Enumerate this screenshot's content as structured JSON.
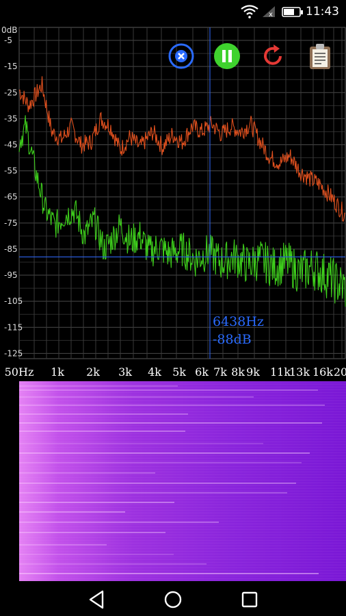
{
  "status_bar": {
    "time": "11:43"
  },
  "toolbar": {
    "buttons": [
      {
        "name": "clear-button",
        "icon": "close-circle-icon",
        "color": "#2a6bff"
      },
      {
        "name": "pause-button",
        "icon": "pause-circle-icon",
        "color": "#3fd22e"
      },
      {
        "name": "refresh-button",
        "icon": "refresh-icon",
        "color": "#e53935"
      },
      {
        "name": "clipboard-button",
        "icon": "clipboard-icon",
        "color": "#8d6e53"
      }
    ]
  },
  "readout": {
    "frequency": "6438Hz",
    "level": "-88dB"
  },
  "chart_data": {
    "type": "line",
    "y_axis": {
      "unit": "0dB",
      "ticks": [
        "-5",
        "-15",
        "-25",
        "-35",
        "-45",
        "-55",
        "-65",
        "-75",
        "-85",
        "-95",
        "-105",
        "-115",
        "-125"
      ]
    },
    "x_axis": {
      "ticks": [
        "50Hz",
        "1k",
        "2k",
        "3k",
        "4k",
        "5k",
        "6k",
        "7k",
        "8k",
        "9k",
        "11k",
        "13k",
        "16k",
        "20"
      ]
    },
    "cursor": {
      "frequency_hz": 6438,
      "level_db": -88
    },
    "series": [
      {
        "color": "#e0501e",
        "points": [
          [
            0,
            -24
          ],
          [
            0.03,
            -30
          ],
          [
            0.07,
            -22
          ],
          [
            0.1,
            -40
          ],
          [
            0.13,
            -43
          ],
          [
            0.16,
            -38
          ],
          [
            0.19,
            -45
          ],
          [
            0.22,
            -44
          ],
          [
            0.25,
            -35
          ],
          [
            0.28,
            -38
          ],
          [
            0.31,
            -47
          ],
          [
            0.34,
            -42
          ],
          [
            0.37,
            -46
          ],
          [
            0.41,
            -40
          ],
          [
            0.44,
            -46
          ],
          [
            0.47,
            -41
          ],
          [
            0.5,
            -44
          ],
          [
            0.53,
            -38
          ],
          [
            0.56,
            -40
          ],
          [
            0.59,
            -37
          ],
          [
            0.62,
            -41
          ],
          [
            0.65,
            -38
          ],
          [
            0.68,
            -40
          ],
          [
            0.71,
            -37
          ],
          [
            0.74,
            -44
          ],
          [
            0.77,
            -50
          ],
          [
            0.8,
            -52
          ],
          [
            0.83,
            -49
          ],
          [
            0.86,
            -55
          ],
          [
            0.89,
            -58
          ],
          [
            0.92,
            -60
          ],
          [
            0.95,
            -64
          ],
          [
            1.0,
            -72
          ]
        ]
      },
      {
        "color": "#3ecf1c",
        "points": [
          [
            0,
            -44
          ],
          [
            0.02,
            -38
          ],
          [
            0.05,
            -55
          ],
          [
            0.08,
            -70
          ],
          [
            0.11,
            -76
          ],
          [
            0.14,
            -72
          ],
          [
            0.17,
            -70
          ],
          [
            0.2,
            -80
          ],
          [
            0.23,
            -74
          ],
          [
            0.26,
            -85
          ],
          [
            0.28,
            -82
          ],
          [
            0.31,
            -76
          ],
          [
            0.34,
            -82
          ],
          [
            0.37,
            -80
          ],
          [
            0.4,
            -86
          ],
          [
            0.43,
            -84
          ],
          [
            0.46,
            -87
          ],
          [
            0.5,
            -85
          ],
          [
            0.54,
            -89
          ],
          [
            0.58,
            -86
          ],
          [
            0.62,
            -90
          ],
          [
            0.66,
            -88
          ],
          [
            0.7,
            -91
          ],
          [
            0.74,
            -89
          ],
          [
            0.78,
            -92
          ],
          [
            0.82,
            -90
          ],
          [
            0.86,
            -94
          ],
          [
            0.9,
            -92
          ],
          [
            0.94,
            -95
          ],
          [
            1.0,
            -100
          ]
        ]
      }
    ]
  }
}
